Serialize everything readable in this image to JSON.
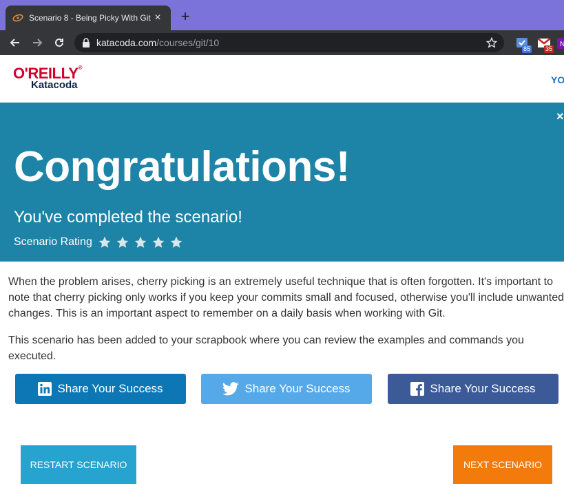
{
  "browser": {
    "tab_title": "Scenario 8 - Being Picky With Git",
    "tab_close": "×",
    "new_tab": "+",
    "url_host": "katacoda.com",
    "url_path": "/courses/git/10",
    "extensions": [
      {
        "name": "ext-blue",
        "badge": "85",
        "color": "#3b78e7"
      },
      {
        "name": "gmail",
        "badge": "35",
        "color": "#c5221f"
      },
      {
        "name": "onenote",
        "badge": "",
        "color": "#7719aa"
      }
    ]
  },
  "header": {
    "logo_primary": "O'REILLY",
    "logo_secondary": "Katacoda",
    "link_partial": "YO"
  },
  "banner": {
    "close": "×",
    "title": "Congratulations!",
    "subtitle": "You've completed the scenario!",
    "rating_label": "Scenario Rating",
    "star_count": 5
  },
  "content": {
    "paragraph1": "When the problem arises, cherry picking is an extremely useful technique that is often forgotten. It's important to note that cherry picking only works if you keep your commits small and focused, otherwise you'll include unwanted changes. This is an important aspect to remember on a daily basis when working with Git.",
    "paragraph2": "This scenario has been added to your scrapbook where you can review the examples and commands you executed."
  },
  "share": {
    "linkedin": "Share Your Success",
    "twitter": "Share Your Success",
    "facebook": "Share Your Success"
  },
  "actions": {
    "restart": "RESTART SCENARIO",
    "next": "NEXT SCENARIO"
  },
  "colors": {
    "banner": "#1d84a8",
    "linkedin": "#0d77b5",
    "twitter": "#56a9e9",
    "facebook": "#3c5a98",
    "restart": "#26a3cf",
    "next": "#f27b0c"
  }
}
